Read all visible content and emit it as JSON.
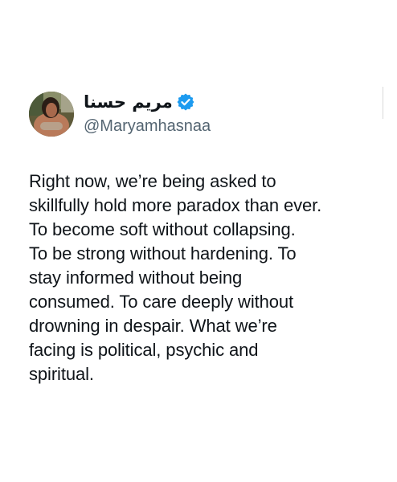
{
  "tweet": {
    "author": {
      "display_name": "مريم حسنا",
      "handle": "@Maryamhasnaa",
      "verified_icon": "verified-badge-icon",
      "avatar_icon": "avatar"
    },
    "text_lines": [
      "Right now, we’re being asked to",
      "skillfully hold more paradox than ever.",
      "To become soft without collapsing.",
      "To be strong without hardening. To",
      "stay informed without being",
      "consumed. To care deeply without",
      "drowning in despair. What we’re",
      "facing is political, psychic and",
      "spiritual."
    ]
  },
  "colors": {
    "text": "#0f1419",
    "secondary": "#536471",
    "verified": "#1d9bf0"
  }
}
